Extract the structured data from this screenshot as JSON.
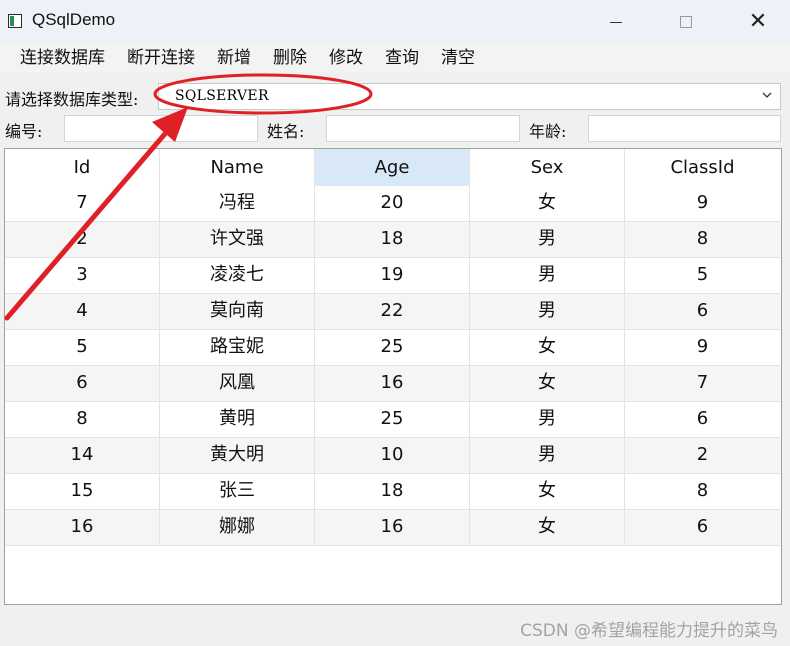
{
  "window": {
    "title": "QSqlDemo"
  },
  "menu": [
    "连接数据库",
    "断开连接",
    "新增",
    "删除",
    "修改",
    "查询",
    "清空"
  ],
  "db_type": {
    "label": "请选择数据库类型:",
    "value": "SQLSERVER"
  },
  "fields": {
    "id_label": "编号:",
    "name_label": "姓名:",
    "age_label": "年龄:"
  },
  "table": {
    "columns": [
      "Id",
      "Name",
      "Age",
      "Sex",
      "ClassId"
    ],
    "rows": [
      [
        "7",
        "冯程",
        "20",
        "女",
        "9"
      ],
      [
        "2",
        "许文强",
        "18",
        "男",
        "8"
      ],
      [
        "3",
        "凌凌七",
        "19",
        "男",
        "5"
      ],
      [
        "4",
        "莫向南",
        "22",
        "男",
        "6"
      ],
      [
        "5",
        "路宝妮",
        "25",
        "女",
        "9"
      ],
      [
        "6",
        "风凰",
        "16",
        "女",
        "7"
      ],
      [
        "8",
        "黄明",
        "25",
        "男",
        "6"
      ],
      [
        "14",
        "黄大明",
        "10",
        "男",
        "2"
      ],
      [
        "15",
        "张三",
        "18",
        "女",
        "8"
      ],
      [
        "16",
        "娜娜",
        "16",
        "女",
        "6"
      ]
    ]
  },
  "watermark": "CSDN @希望编程能力提升的菜鸟",
  "colors": {
    "annotation": "#e02027",
    "selected_header": "#d9e8f6"
  }
}
